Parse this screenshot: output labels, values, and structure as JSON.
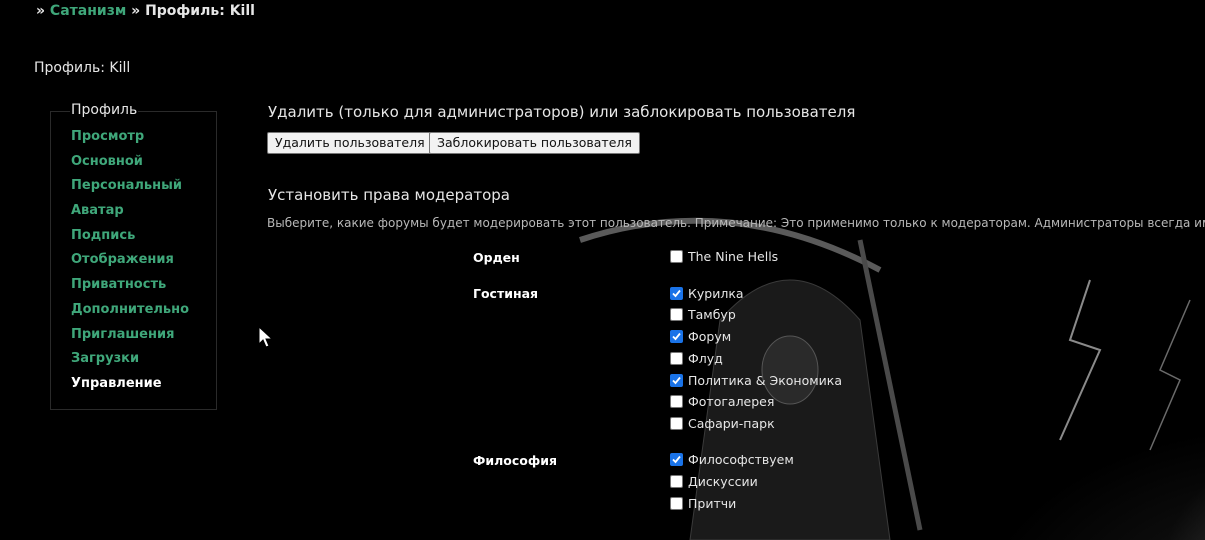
{
  "breadcrumb": {
    "sep1": "»",
    "link": "Сатанизм",
    "sep2": "»",
    "current": "Профиль: Kill"
  },
  "page_title": "Профиль: Kill",
  "sidebar": {
    "legend": "Профиль",
    "items": [
      {
        "label": "Просмотр"
      },
      {
        "label": "Основной"
      },
      {
        "label": "Персональный"
      },
      {
        "label": "Аватар"
      },
      {
        "label": "Подпись"
      },
      {
        "label": "Отображения"
      },
      {
        "label": "Приватность"
      },
      {
        "label": "Дополнительно"
      },
      {
        "label": "Приглашения"
      },
      {
        "label": "Загрузки"
      },
      {
        "label": "Управление",
        "active": true
      }
    ]
  },
  "delete_section": {
    "heading": "Удалить (только для администраторов) или заблокировать пользователя",
    "delete_button": "Удалить пользователя",
    "ban_button": "Заблокировать пользователя"
  },
  "moderator_section": {
    "heading": "Установить права модератора",
    "note": "Выберите, какие форумы будет модерировать этот пользователь. Примечание: Это применимо только к модераторам. Администраторы всегда имеют",
    "categories": [
      {
        "name": "Орден",
        "forums": [
          {
            "label": "The Nine Hells",
            "checked": false
          }
        ]
      },
      {
        "name": "Гостиная",
        "forums": [
          {
            "label": "Курилка",
            "checked": true
          },
          {
            "label": "Тамбур",
            "checked": false
          },
          {
            "label": "Форум",
            "checked": true
          },
          {
            "label": "Флуд",
            "checked": false
          },
          {
            "label": "Политика & Экономика",
            "checked": true
          },
          {
            "label": "Фотогалерея",
            "checked": false
          },
          {
            "label": "Сафари-парк",
            "checked": false
          }
        ]
      },
      {
        "name": "Философия",
        "forums": [
          {
            "label": "Философствуем",
            "checked": true
          },
          {
            "label": "Дискуссии",
            "checked": false
          },
          {
            "label": "Притчи",
            "checked": false
          }
        ]
      }
    ]
  },
  "colors": {
    "background": "#000000",
    "link": "#3fa77a",
    "text": "#e6e6e6",
    "checkbox_checked": "#1a73e8"
  }
}
